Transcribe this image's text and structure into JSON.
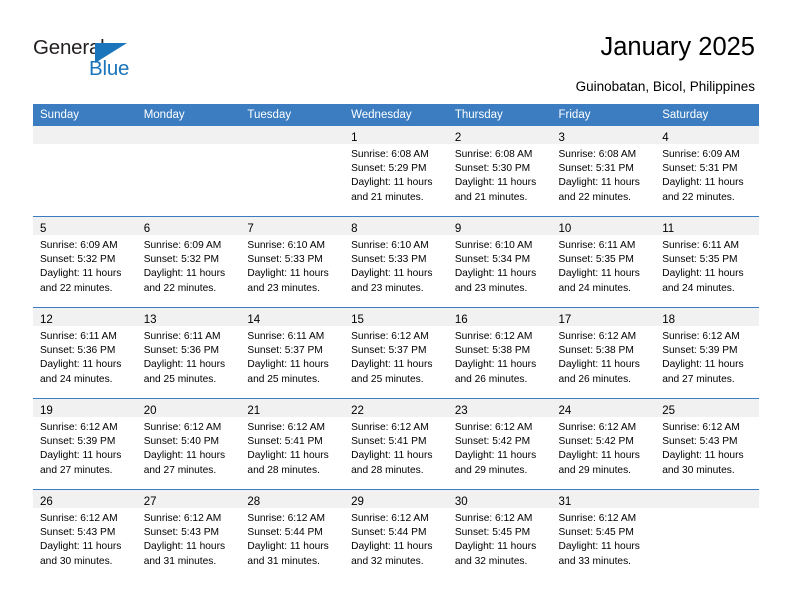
{
  "brand": {
    "name_part1": "General",
    "name_part2": "Blue",
    "flag_icon": "blue-triangle-flag"
  },
  "header": {
    "title": "January 2025",
    "subtitle": "Guinobatan, Bicol, Philippines",
    "accent_color": "#3b7dc0",
    "brand_blue": "#1b75bb",
    "band_gray": "#f1f1f1"
  },
  "weekday_headers": [
    "Sunday",
    "Monday",
    "Tuesday",
    "Wednesday",
    "Thursday",
    "Friday",
    "Saturday"
  ],
  "weeks": [
    [
      {
        "day": "",
        "lines": []
      },
      {
        "day": "",
        "lines": []
      },
      {
        "day": "",
        "lines": []
      },
      {
        "day": "1",
        "lines": [
          "Sunrise: 6:08 AM",
          "Sunset: 5:29 PM",
          "Daylight: 11 hours",
          "and 21 minutes."
        ]
      },
      {
        "day": "2",
        "lines": [
          "Sunrise: 6:08 AM",
          "Sunset: 5:30 PM",
          "Daylight: 11 hours",
          "and 21 minutes."
        ]
      },
      {
        "day": "3",
        "lines": [
          "Sunrise: 6:08 AM",
          "Sunset: 5:31 PM",
          "Daylight: 11 hours",
          "and 22 minutes."
        ]
      },
      {
        "day": "4",
        "lines": [
          "Sunrise: 6:09 AM",
          "Sunset: 5:31 PM",
          "Daylight: 11 hours",
          "and 22 minutes."
        ]
      }
    ],
    [
      {
        "day": "5",
        "lines": [
          "Sunrise: 6:09 AM",
          "Sunset: 5:32 PM",
          "Daylight: 11 hours",
          "and 22 minutes."
        ]
      },
      {
        "day": "6",
        "lines": [
          "Sunrise: 6:09 AM",
          "Sunset: 5:32 PM",
          "Daylight: 11 hours",
          "and 22 minutes."
        ]
      },
      {
        "day": "7",
        "lines": [
          "Sunrise: 6:10 AM",
          "Sunset: 5:33 PM",
          "Daylight: 11 hours",
          "and 23 minutes."
        ]
      },
      {
        "day": "8",
        "lines": [
          "Sunrise: 6:10 AM",
          "Sunset: 5:33 PM",
          "Daylight: 11 hours",
          "and 23 minutes."
        ]
      },
      {
        "day": "9",
        "lines": [
          "Sunrise: 6:10 AM",
          "Sunset: 5:34 PM",
          "Daylight: 11 hours",
          "and 23 minutes."
        ]
      },
      {
        "day": "10",
        "lines": [
          "Sunrise: 6:11 AM",
          "Sunset: 5:35 PM",
          "Daylight: 11 hours",
          "and 24 minutes."
        ]
      },
      {
        "day": "11",
        "lines": [
          "Sunrise: 6:11 AM",
          "Sunset: 5:35 PM",
          "Daylight: 11 hours",
          "and 24 minutes."
        ]
      }
    ],
    [
      {
        "day": "12",
        "lines": [
          "Sunrise: 6:11 AM",
          "Sunset: 5:36 PM",
          "Daylight: 11 hours",
          "and 24 minutes."
        ]
      },
      {
        "day": "13",
        "lines": [
          "Sunrise: 6:11 AM",
          "Sunset: 5:36 PM",
          "Daylight: 11 hours",
          "and 25 minutes."
        ]
      },
      {
        "day": "14",
        "lines": [
          "Sunrise: 6:11 AM",
          "Sunset: 5:37 PM",
          "Daylight: 11 hours",
          "and 25 minutes."
        ]
      },
      {
        "day": "15",
        "lines": [
          "Sunrise: 6:12 AM",
          "Sunset: 5:37 PM",
          "Daylight: 11 hours",
          "and 25 minutes."
        ]
      },
      {
        "day": "16",
        "lines": [
          "Sunrise: 6:12 AM",
          "Sunset: 5:38 PM",
          "Daylight: 11 hours",
          "and 26 minutes."
        ]
      },
      {
        "day": "17",
        "lines": [
          "Sunrise: 6:12 AM",
          "Sunset: 5:38 PM",
          "Daylight: 11 hours",
          "and 26 minutes."
        ]
      },
      {
        "day": "18",
        "lines": [
          "Sunrise: 6:12 AM",
          "Sunset: 5:39 PM",
          "Daylight: 11 hours",
          "and 27 minutes."
        ]
      }
    ],
    [
      {
        "day": "19",
        "lines": [
          "Sunrise: 6:12 AM",
          "Sunset: 5:39 PM",
          "Daylight: 11 hours",
          "and 27 minutes."
        ]
      },
      {
        "day": "20",
        "lines": [
          "Sunrise: 6:12 AM",
          "Sunset: 5:40 PM",
          "Daylight: 11 hours",
          "and 27 minutes."
        ]
      },
      {
        "day": "21",
        "lines": [
          "Sunrise: 6:12 AM",
          "Sunset: 5:41 PM",
          "Daylight: 11 hours",
          "and 28 minutes."
        ]
      },
      {
        "day": "22",
        "lines": [
          "Sunrise: 6:12 AM",
          "Sunset: 5:41 PM",
          "Daylight: 11 hours",
          "and 28 minutes."
        ]
      },
      {
        "day": "23",
        "lines": [
          "Sunrise: 6:12 AM",
          "Sunset: 5:42 PM",
          "Daylight: 11 hours",
          "and 29 minutes."
        ]
      },
      {
        "day": "24",
        "lines": [
          "Sunrise: 6:12 AM",
          "Sunset: 5:42 PM",
          "Daylight: 11 hours",
          "and 29 minutes."
        ]
      },
      {
        "day": "25",
        "lines": [
          "Sunrise: 6:12 AM",
          "Sunset: 5:43 PM",
          "Daylight: 11 hours",
          "and 30 minutes."
        ]
      }
    ],
    [
      {
        "day": "26",
        "lines": [
          "Sunrise: 6:12 AM",
          "Sunset: 5:43 PM",
          "Daylight: 11 hours",
          "and 30 minutes."
        ]
      },
      {
        "day": "27",
        "lines": [
          "Sunrise: 6:12 AM",
          "Sunset: 5:43 PM",
          "Daylight: 11 hours",
          "and 31 minutes."
        ]
      },
      {
        "day": "28",
        "lines": [
          "Sunrise: 6:12 AM",
          "Sunset: 5:44 PM",
          "Daylight: 11 hours",
          "and 31 minutes."
        ]
      },
      {
        "day": "29",
        "lines": [
          "Sunrise: 6:12 AM",
          "Sunset: 5:44 PM",
          "Daylight: 11 hours",
          "and 32 minutes."
        ]
      },
      {
        "day": "30",
        "lines": [
          "Sunrise: 6:12 AM",
          "Sunset: 5:45 PM",
          "Daylight: 11 hours",
          "and 32 minutes."
        ]
      },
      {
        "day": "31",
        "lines": [
          "Sunrise: 6:12 AM",
          "Sunset: 5:45 PM",
          "Daylight: 11 hours",
          "and 33 minutes."
        ]
      },
      {
        "day": "",
        "lines": []
      }
    ]
  ]
}
